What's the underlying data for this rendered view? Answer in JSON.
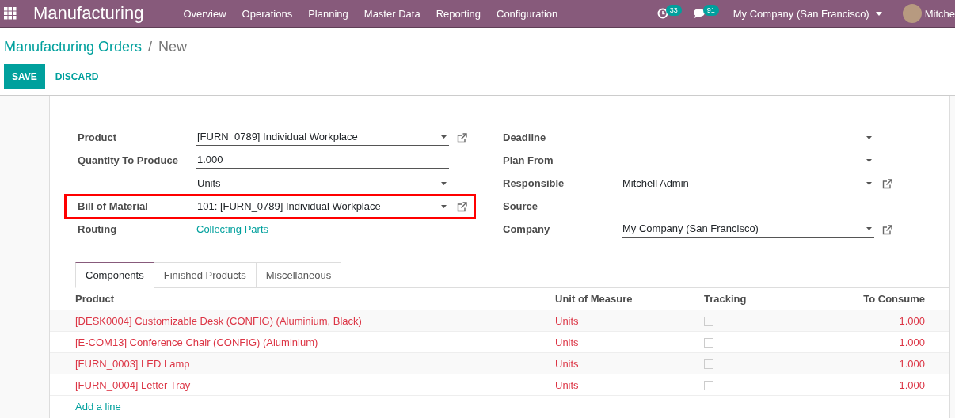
{
  "navbar": {
    "app_name": "Manufacturing",
    "menu": [
      "Overview",
      "Operations",
      "Planning",
      "Master Data",
      "Reporting",
      "Configuration"
    ],
    "activity_count": "33",
    "message_count": "91",
    "company": "My Company (San Francisco)",
    "user": "Mitche"
  },
  "breadcrumb": {
    "parent": "Manufacturing Orders",
    "separator": "/",
    "current": "New"
  },
  "buttons": {
    "save": "SAVE",
    "discard": "DISCARD"
  },
  "form": {
    "left_fields": [
      {
        "label": "Product",
        "kind": "many2one",
        "value": "[FURN_0789] Individual Workplace",
        "highlighted": false
      },
      {
        "label": "Quantity To Produce",
        "kind": "input",
        "value": "1.000",
        "highlighted": false
      },
      {
        "kind": "select",
        "value": "Units",
        "highlighted": false
      },
      {
        "label": "Bill of Material",
        "kind": "many2one",
        "value": "101: [FURN_0789] Individual Workplace",
        "highlighted": true
      },
      {
        "label": "Routing",
        "kind": "link",
        "value": "Collecting Parts",
        "highlighted": false
      }
    ],
    "right_fields": [
      {
        "label": "Deadline",
        "kind": "select"
      },
      {
        "label": "Plan From",
        "kind": "select"
      },
      {
        "label": "Responsible",
        "kind": "many2one",
        "value": "Mitchell Admin"
      },
      {
        "label": "Source",
        "kind": "input"
      },
      {
        "label": "Company",
        "kind": "many2one",
        "value": "My Company (San Francisco)"
      }
    ]
  },
  "tabs": [
    {
      "label": "Components",
      "selected": true
    },
    {
      "label": "Finished Products",
      "selected": false
    },
    {
      "label": "Miscellaneous",
      "selected": false
    }
  ],
  "table": {
    "columns": [
      "Product",
      "Unit of Measure",
      "Tracking",
      "To Consume"
    ],
    "rows": [
      {
        "product": "[DESK0004] Customizable Desk (CONFIG) (Aluminium, Black)",
        "unit": "Units",
        "tracking": false,
        "to_consume": "1.000"
      },
      {
        "product": "[E-COM13] Conference Chair (CONFIG) (Aluminium)",
        "unit": "Units",
        "tracking": false,
        "to_consume": "1.000"
      },
      {
        "product": "[FURN_0003] LED Lamp",
        "unit": "Units",
        "tracking": false,
        "to_consume": "1.000"
      },
      {
        "product": "[FURN_0004] Letter Tray",
        "unit": "Units",
        "tracking": false,
        "to_consume": "1.000"
      }
    ],
    "add_line": "Add a line"
  }
}
